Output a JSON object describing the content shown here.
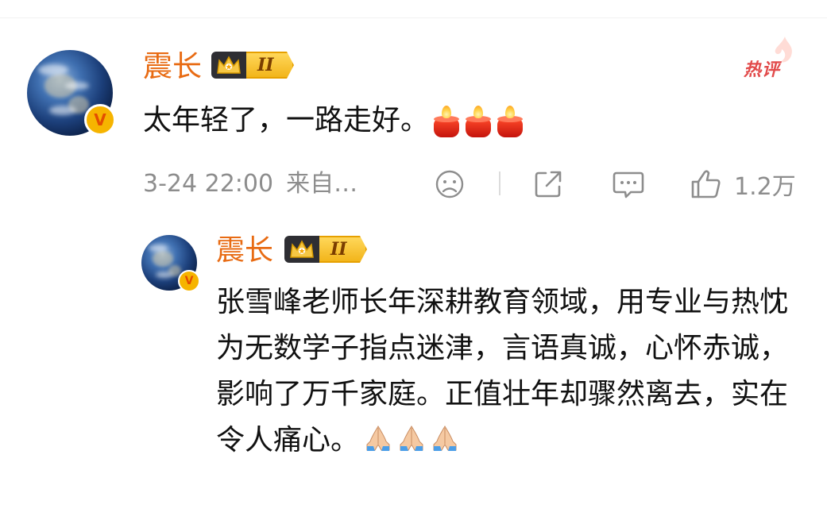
{
  "main_comment": {
    "username": "震长",
    "level": "II",
    "hot_label": "热评",
    "text": "太年轻了，一路走好。",
    "emojis": [
      "candle-emoji",
      "candle-emoji",
      "candle-emoji"
    ],
    "timestamp": "3-24 22:00",
    "source": "来自…",
    "like_count": "1.2万",
    "verified_mark": "V"
  },
  "reply": {
    "username": "震长",
    "level": "II",
    "text": "张雪峰老师长年深耕教育领域，用专业与热忱为无数学子指点迷津，言语真诚，心怀赤诚，影响了万千家庭。正值壮年却骤然离去，实在令人痛心。",
    "emojis": [
      "praying-hands-emoji",
      "praying-hands-emoji",
      "praying-hands-emoji"
    ],
    "verified_mark": "V"
  },
  "colors": {
    "username": "#e86b13",
    "hot_label": "#e24b4b",
    "meta_text": "#8d8d8d",
    "body_text": "#111111",
    "level_badge": "#f2b51b"
  }
}
